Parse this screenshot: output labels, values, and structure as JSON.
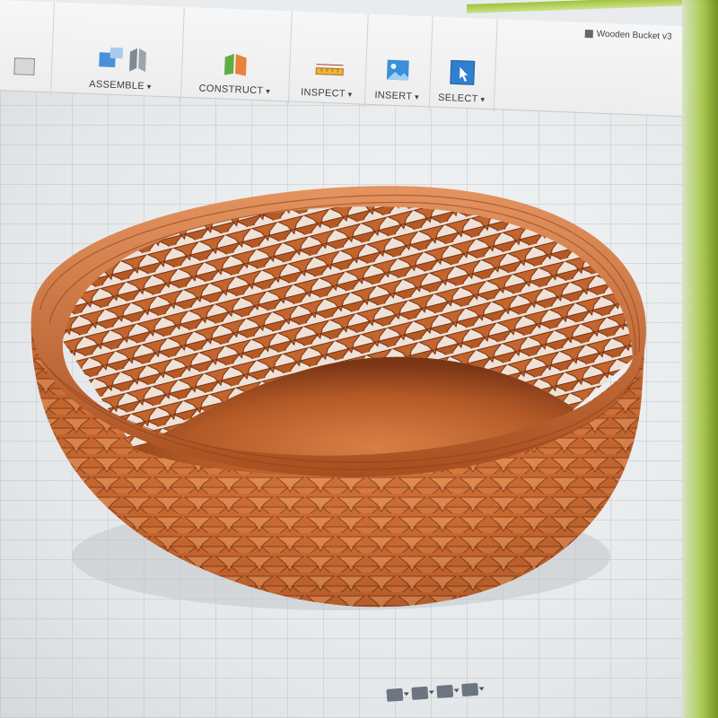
{
  "toolbar": {
    "groups": [
      {
        "label": "ASSEMBLE",
        "icon": "assemble-icon"
      },
      {
        "label": "CONSTRUCT",
        "icon": "construct-plane-icon"
      },
      {
        "label": "INSPECT",
        "icon": "measure-ruler-icon"
      },
      {
        "label": "INSERT",
        "icon": "insert-image-icon"
      },
      {
        "label": "SELECT",
        "icon": "select-cursor-icon"
      }
    ]
  },
  "document": {
    "title": "Wooden Bucket v3"
  },
  "model": {
    "name": "woven-wooden-bowl",
    "color_wood": "#c86a34",
    "color_wood_dark": "#8a3f1a"
  },
  "navbar": {
    "buttons": [
      "orbit-icon",
      "display-settings-icon",
      "grid-settings-icon",
      "viewports-icon"
    ]
  }
}
